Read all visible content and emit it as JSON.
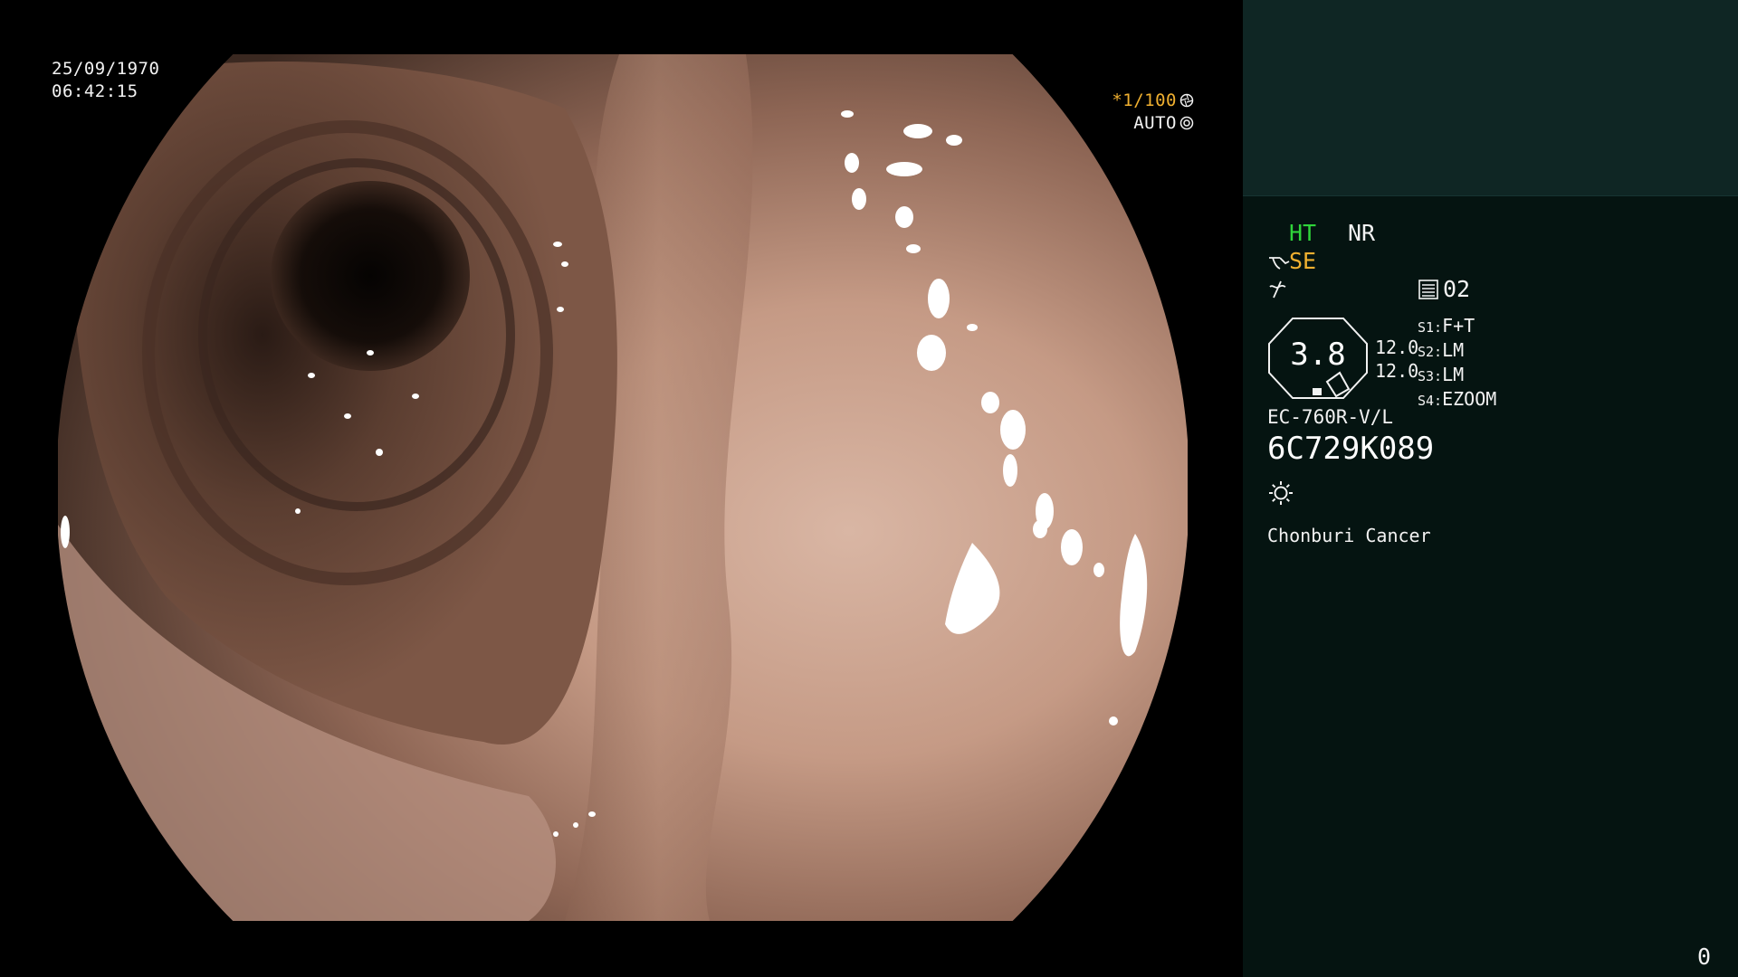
{
  "scope_view": {
    "datetime": {
      "date": "25/09/1970",
      "time": "06:42:15"
    },
    "shutter": {
      "value": "*1/100",
      "mode": "AUTO",
      "shutter_icon": "aperture-icon",
      "auto_icon": "auto-iris-icon"
    }
  },
  "info_panel": {
    "modes": {
      "ht": "HT",
      "nr": "NR",
      "ht_color": "#2fd43a",
      "nr_color": "#f2f2f2"
    },
    "se": {
      "icon": "structure-enhance-icon",
      "label": "SE",
      "color": "#f0b030"
    },
    "row3": {
      "left_icon": "slash-curve-icon",
      "memory_icon": "memory-card-icon",
      "memory_value": "02"
    },
    "scope": {
      "value": "3.8",
      "sub_a": "12.0",
      "sub_b": "12.0",
      "switches": [
        {
          "key": "S1:",
          "value": "F+T"
        },
        {
          "key": "S2:",
          "value": "LM"
        },
        {
          "key": "S3:",
          "value": "LM"
        },
        {
          "key": "S4:",
          "value": "EZOOM"
        }
      ]
    },
    "model": "EC-760R-V/L",
    "serial": "6C729K089",
    "light_icon": "light-source-icon",
    "institution": "Chonburi Cancer",
    "counter": "0"
  },
  "colors": {
    "panel_bg": "#051411",
    "panel_top_bg": "#0f2624",
    "accent_orange": "#f0b030",
    "accent_green": "#2fd43a"
  }
}
